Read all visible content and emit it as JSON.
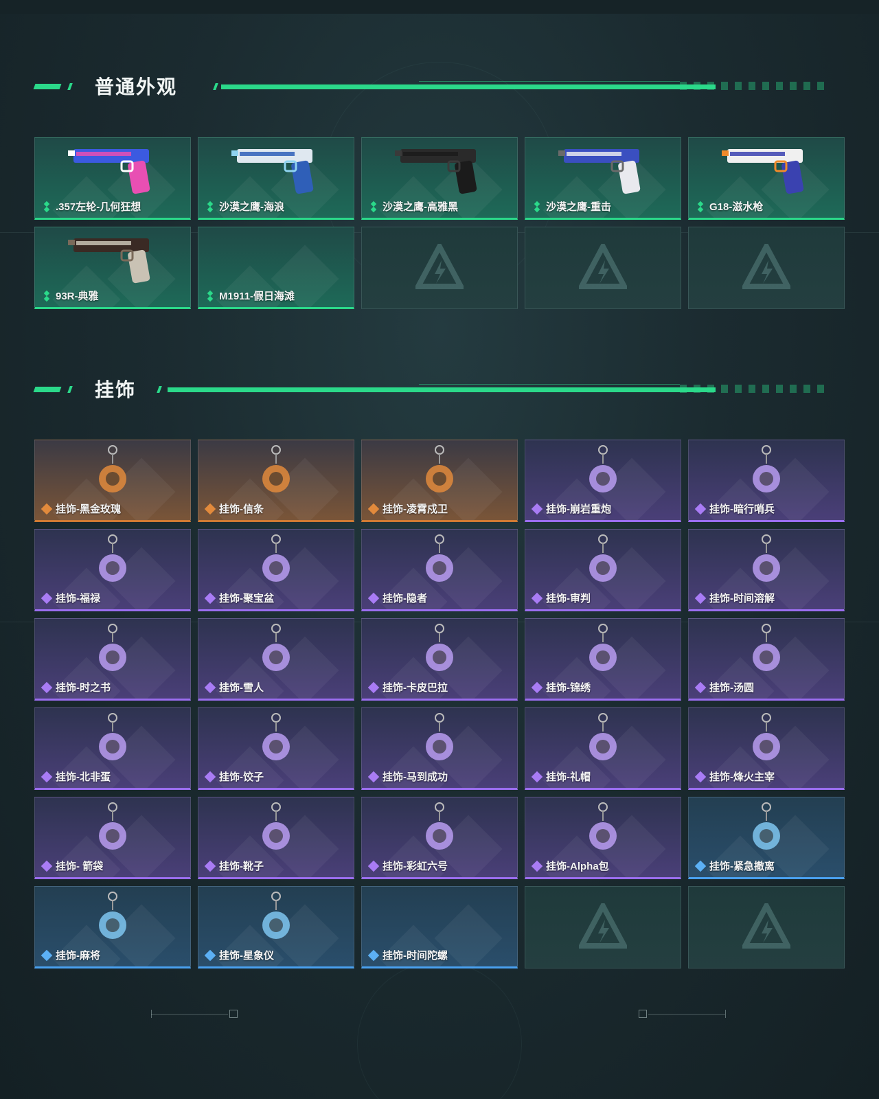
{
  "sections": [
    {
      "title": "普通外观",
      "items": [
        {
          "label": ".357左轮-几何狂想",
          "rarity": "green",
          "icon": "revolver-icon",
          "colors": [
            "#e84fb3",
            "#3b5ae0",
            "#ffffff"
          ]
        },
        {
          "label": "沙漠之鹰-海浪",
          "rarity": "green",
          "icon": "pistol-icon",
          "colors": [
            "#2f5fb8",
            "#dfe8f0",
            "#8fd3f0"
          ]
        },
        {
          "label": "沙漠之鹰-高雅黑",
          "rarity": "green",
          "icon": "pistol-icon",
          "colors": [
            "#1b1b1b",
            "#2a2a2a",
            "#3a3a3a"
          ]
        },
        {
          "label": "沙漠之鹰-重击",
          "rarity": "green",
          "icon": "pistol-icon",
          "colors": [
            "#e9e9ee",
            "#3a4fc0",
            "#6a6a6a"
          ]
        },
        {
          "label": "G18-滋水枪",
          "rarity": "green",
          "icon": "pistol-icon",
          "colors": [
            "#3a42b0",
            "#f0f0f0",
            "#f08a2a"
          ]
        },
        {
          "label": "93R-典雅",
          "rarity": "green",
          "icon": "pistol-icon",
          "colors": [
            "#c9c2b4",
            "#3a2a24",
            "#7a6a5a"
          ]
        },
        {
          "label": "M1911-假日海滩",
          "rarity": "green",
          "icon": "",
          "colors": []
        },
        {
          "empty": true
        },
        {
          "empty": true
        },
        {
          "empty": true
        }
      ]
    },
    {
      "title": "挂饰",
      "items": [
        {
          "label": "挂饰-黑金玫瑰",
          "rarity": "orange",
          "icon": "charm-icon"
        },
        {
          "label": "挂饰-信条",
          "rarity": "orange",
          "icon": "charm-icon"
        },
        {
          "label": "挂饰-凌霄戍卫",
          "rarity": "orange",
          "icon": "charm-icon"
        },
        {
          "label": "挂饰-崩岩重炮",
          "rarity": "purple",
          "icon": "charm-icon"
        },
        {
          "label": "挂饰-暗行哨兵",
          "rarity": "purple",
          "icon": "charm-icon"
        },
        {
          "label": "挂饰-福禄",
          "rarity": "purple",
          "icon": "charm-icon"
        },
        {
          "label": "挂饰-聚宝盆",
          "rarity": "purple",
          "icon": "charm-icon"
        },
        {
          "label": "挂饰-隐者",
          "rarity": "purple",
          "icon": "charm-icon"
        },
        {
          "label": "挂饰-审判",
          "rarity": "purple",
          "icon": "charm-icon"
        },
        {
          "label": "挂饰-时间溶解",
          "rarity": "purple",
          "icon": "charm-icon"
        },
        {
          "label": "挂饰-时之书",
          "rarity": "purple",
          "icon": "charm-icon"
        },
        {
          "label": "挂饰-雪人",
          "rarity": "purple",
          "icon": "charm-icon"
        },
        {
          "label": "挂饰-卡皮巴拉",
          "rarity": "purple",
          "icon": "charm-icon"
        },
        {
          "label": "挂饰-锦绣",
          "rarity": "purple",
          "icon": "charm-icon"
        },
        {
          "label": "挂饰-汤圆",
          "rarity": "purple",
          "icon": "charm-icon"
        },
        {
          "label": "挂饰-北非蛋",
          "rarity": "purple",
          "icon": "charm-icon"
        },
        {
          "label": "挂饰-饺子",
          "rarity": "purple",
          "icon": "charm-icon"
        },
        {
          "label": "挂饰-马到成功",
          "rarity": "purple",
          "icon": "charm-icon"
        },
        {
          "label": "挂饰-礼帽",
          "rarity": "purple",
          "icon": "charm-icon"
        },
        {
          "label": "挂饰-烽火主宰",
          "rarity": "purple",
          "icon": "charm-icon"
        },
        {
          "label": "挂饰- 箭袋",
          "rarity": "purple",
          "icon": "charm-icon"
        },
        {
          "label": "挂饰-靴子",
          "rarity": "purple",
          "icon": "charm-icon"
        },
        {
          "label": "挂饰-彩虹六号",
          "rarity": "purple",
          "icon": "charm-icon"
        },
        {
          "label": "挂饰-Alpha包",
          "rarity": "purple",
          "icon": "charm-icon"
        },
        {
          "label": "挂饰-紧急撤离",
          "rarity": "blue",
          "icon": "charm-icon"
        },
        {
          "label": "挂饰-麻将",
          "rarity": "blue",
          "icon": "charm-icon"
        },
        {
          "label": "挂饰-星象仪",
          "rarity": "blue",
          "icon": "charm-icon"
        },
        {
          "label": "挂饰-时间陀螺",
          "rarity": "blue",
          "icon": ""
        },
        {
          "empty": true
        },
        {
          "empty": true
        }
      ]
    }
  ],
  "theme": {
    "accent": "#2bd98a",
    "orange": "#d07a33",
    "purple": "#9b6ef0",
    "blue": "#4aa1f0"
  }
}
